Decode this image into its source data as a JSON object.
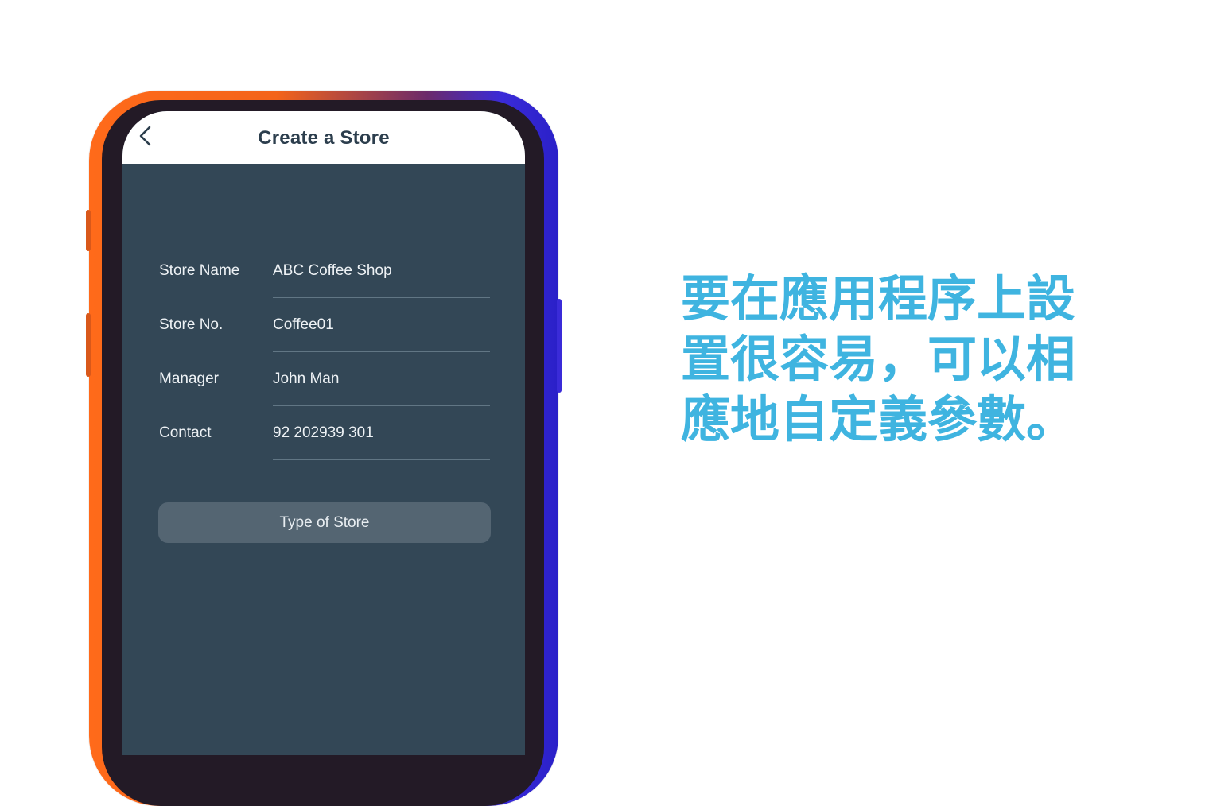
{
  "header": {
    "title": "Create a Store",
    "back_icon": "chevron-left-icon"
  },
  "form": {
    "fields": [
      {
        "label": "Store Name",
        "value": "ABC Coffee Shop"
      },
      {
        "label": "Store No.",
        "value": "Coffee01"
      },
      {
        "label": "Manager",
        "value": "John Man"
      },
      {
        "label": "Contact",
        "value": "92 202939 301"
      }
    ]
  },
  "type_button": {
    "label": "Type of Store"
  },
  "caption": {
    "lines": [
      "要在應用程序上設",
      "置很容易，可以相",
      "應地自定義參數。"
    ]
  },
  "colors": {
    "caption": "#3fb4e0",
    "screen_background": "#334756",
    "header_background": "#ffffff",
    "phone_frame_orange": "#ff6a1a",
    "phone_frame_blue": "#3a2bd8"
  }
}
